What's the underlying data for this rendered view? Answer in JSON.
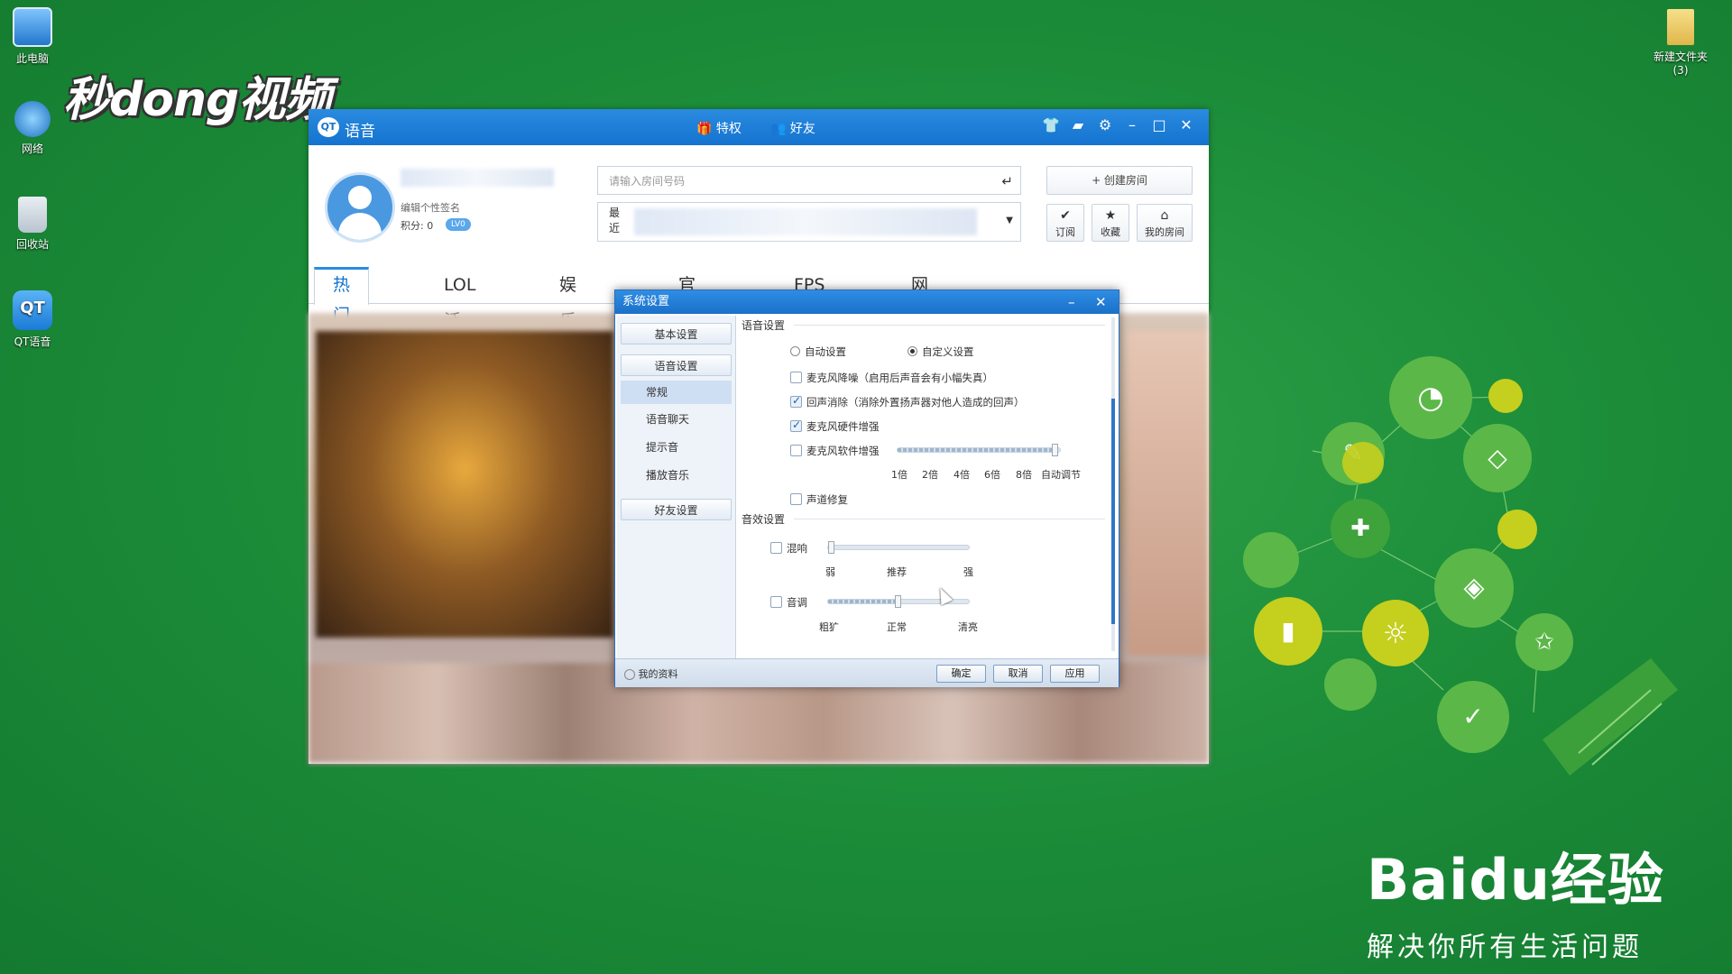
{
  "desktop": {
    "icons": [
      {
        "label": "此电脑"
      },
      {
        "label": "网络"
      },
      {
        "label": "回收站"
      },
      {
        "label": "QT语音"
      }
    ],
    "top_right_icon": {
      "label": "新建文件夹",
      "sub": "(3)"
    }
  },
  "watermark": {
    "video_brand": "秒dong视频",
    "baidu_main": "Baidu经验",
    "baidu_slogan": "解决你所有生活问题"
  },
  "qt_window": {
    "logo_text": "QT",
    "app_name": "语音",
    "toolbar": {
      "privilege": "特权",
      "friends": "好友"
    },
    "controls": {
      "skin": "👕",
      "message": "▰",
      "settings": "⚙",
      "minimize": "–",
      "maximize": "□",
      "close": "✕"
    },
    "profile": {
      "signature": "编辑个性签名",
      "points_label": "积分: 0",
      "level_badge": "LV0"
    },
    "room_search": {
      "placeholder": "请输入房间号码",
      "enter_icon": "↵"
    },
    "recent": {
      "label_line1": "最",
      "label_line2": "近"
    },
    "create_room": "+ 创建房间",
    "shortcuts": [
      {
        "icon": "✔",
        "label": "订阅"
      },
      {
        "icon": "★",
        "label": "收藏"
      },
      {
        "icon": "⌂",
        "label": "我的房间"
      }
    ],
    "tabs": [
      "热门推荐",
      "LOL活动",
      "娱乐节目",
      "官方房间",
      "FPS推荐",
      "网页游戏"
    ]
  },
  "settings_dialog": {
    "title": "系统设置",
    "controls": {
      "minimize": "–",
      "close": "✕"
    },
    "sidebar": {
      "basic": "基本设置",
      "voice": "语音设置",
      "voice_items": [
        "常规",
        "语音聊天",
        "提示音",
        "播放音乐"
      ],
      "friends": "好友设置"
    },
    "voice_section": {
      "title": "语音设置",
      "auto_radio": "自动设置",
      "custom_radio": "自定义设置",
      "mic_denoise": "麦克风降噪（启用后声音会有小幅失真）",
      "echo_cancel": "回声消除（消除外置扬声器对他人造成的回声）",
      "mic_hw_boost": "麦克风硬件增强",
      "mic_sw_boost": "麦克风软件增强",
      "boost_ticks": [
        "1倍",
        "2倍",
        "4倍",
        "6倍",
        "8倍",
        "自动调节"
      ],
      "boost_level": 1.0,
      "voice_repair": "声道修复"
    },
    "effects_section": {
      "title": "音效设置",
      "reverb": "混响",
      "reverb_ticks": [
        "弱",
        "推荐",
        "强"
      ],
      "reverb_level": 0.0,
      "tone": "音调",
      "tone_ticks": [
        "粗犷",
        "正常",
        "清亮"
      ],
      "tone_level": 0.5
    },
    "footer": {
      "my_profile": "我的资料",
      "ok": "确定",
      "cancel": "取消",
      "apply": "应用"
    },
    "states": {
      "auto_selected": false,
      "custom_selected": true,
      "mic_denoise": false,
      "echo_cancel": true,
      "mic_hw_boost": true,
      "mic_sw_boost": false,
      "voice_repair": false,
      "reverb": false,
      "tone": false
    }
  },
  "colors": {
    "titlebar": "#1a73cf",
    "accent": "#2a8be0",
    "desktop_green": "#1d8e3a"
  }
}
